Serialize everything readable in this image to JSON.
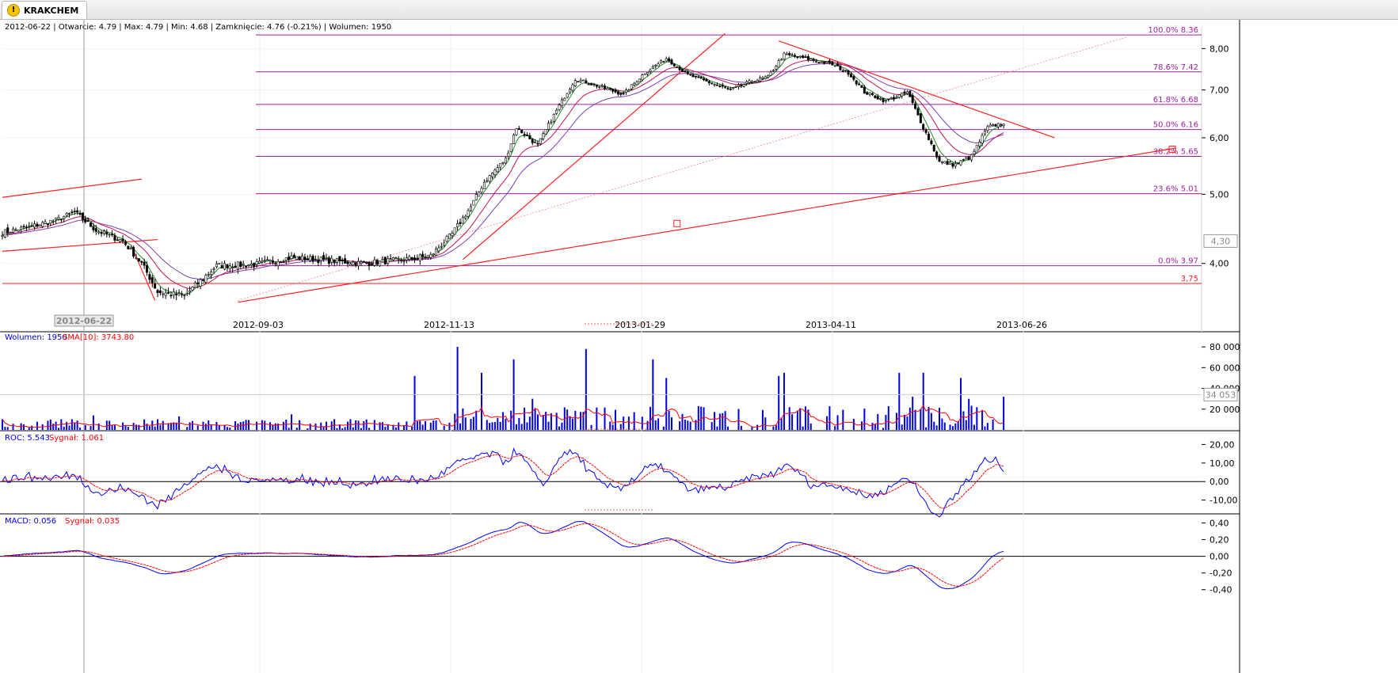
{
  "tab": {
    "title": "KRAKCHEM",
    "icon": "warning-icon"
  },
  "header": {
    "info": "2012-06-22 | Otwarcie: 4.79 | Max: 4.79 | Min: 4.68 | Zamknięcie: 4.76 (-0.21%)  | Wolumen: 1950",
    "cursor_date": "2012-06-22",
    "price_marker": "4,30",
    "volume_marker": "34 053"
  },
  "colors": {
    "candle": "#000000",
    "ema_fast": "#1f8a1f",
    "ema_mid": "#c0145a",
    "ema_slow": "#7b3fb5",
    "trend": "#ff2020",
    "fib": "#a020a0",
    "volume": "#0000dd",
    "signal": "#ff0000",
    "indicator": "#0000ff"
  },
  "chart_data": [
    {
      "type": "candlestick",
      "title": "",
      "x_ticks": [
        "2012-09-03",
        "2012-11-13",
        "2013-01-29",
        "2013-04-11",
        "2013-06-26"
      ],
      "y_ticks": [
        "8,00",
        "7,00",
        "6,00",
        "5,00",
        "4,00"
      ],
      "y_scale": "log",
      "ylim": [
        3.5,
        8.6
      ],
      "fibonacci": [
        {
          "label": "100.0% 8.36",
          "value": 8.36
        },
        {
          "label": "78.6% 7.42",
          "value": 7.42
        },
        {
          "label": "61.8% 6.68",
          "value": 6.68
        },
        {
          "label": "50.0% 6.16",
          "value": 6.16
        },
        {
          "label": "38.2% 5.65",
          "value": 5.65
        },
        {
          "label": "23.6% 5.01",
          "value": 5.01
        },
        {
          "label": "0.0% 3.97",
          "value": 3.97
        }
      ],
      "support_label": "3,75",
      "support_value": 3.75,
      "close_anchors": [
        [
          0,
          4.42
        ],
        [
          10,
          4.5
        ],
        [
          20,
          4.6
        ],
        [
          27,
          4.72
        ],
        [
          35,
          4.45
        ],
        [
          45,
          4.3
        ],
        [
          52,
          4.0
        ],
        [
          58,
          3.65
        ],
        [
          68,
          3.6
        ],
        [
          74,
          3.78
        ],
        [
          80,
          3.97
        ],
        [
          95,
          3.99
        ],
        [
          108,
          4.08
        ],
        [
          118,
          4.05
        ],
        [
          135,
          4.0
        ],
        [
          150,
          4.05
        ],
        [
          160,
          4.1
        ],
        [
          168,
          4.4
        ],
        [
          175,
          4.8
        ],
        [
          180,
          5.2
        ],
        [
          188,
          5.6
        ],
        [
          192,
          6.2
        ],
        [
          200,
          5.85
        ],
        [
          207,
          6.55
        ],
        [
          214,
          7.25
        ],
        [
          222,
          7.1
        ],
        [
          232,
          6.9
        ],
        [
          240,
          7.4
        ],
        [
          248,
          7.75
        ],
        [
          256,
          7.35
        ],
        [
          265,
          7.15
        ],
        [
          272,
          7.0
        ],
        [
          280,
          7.2
        ],
        [
          286,
          7.3
        ],
        [
          292,
          7.85
        ],
        [
          300,
          7.75
        ],
        [
          310,
          7.6
        ],
        [
          316,
          7.4
        ],
        [
          322,
          6.95
        ],
        [
          330,
          6.75
        ],
        [
          338,
          6.95
        ],
        [
          344,
          6.2
        ],
        [
          350,
          5.55
        ],
        [
          356,
          5.5
        ],
        [
          362,
          5.65
        ],
        [
          368,
          6.2
        ],
        [
          374,
          6.3
        ]
      ],
      "volume": {
        "label": "Wolumen: 1950",
        "sma_label": "SMA[10]: 3743.80",
        "y_ticks": [
          "80 000",
          "60 000",
          "40 000",
          "20 000"
        ],
        "ylim": [
          0,
          90000
        ],
        "spikes": [
          [
            18,
            10000
          ],
          [
            34,
            14000
          ],
          [
            66,
            13000
          ],
          [
            108,
            15000
          ],
          [
            154,
            52000
          ],
          [
            170,
            80000
          ],
          [
            179,
            55000
          ],
          [
            191,
            68000
          ],
          [
            198,
            30000
          ],
          [
            218,
            78000
          ],
          [
            243,
            68000
          ],
          [
            248,
            50000
          ],
          [
            290,
            52000
          ],
          [
            292,
            55000
          ],
          [
            335,
            55000
          ],
          [
            344,
            55000
          ],
          [
            358,
            50000
          ],
          [
            340,
            32000
          ],
          [
            361,
            30000
          ],
          [
            374,
            32000
          ]
        ]
      },
      "roc": {
        "label": "ROC: 5.543",
        "signal_label": "Sygnał: 1.061",
        "y_ticks": [
          "20,00",
          "10,00",
          "0,00",
          "-10,00"
        ],
        "ylim": [
          -17,
          27
        ]
      },
      "macd": {
        "label": "MACD: 0.056",
        "signal_label": "Sygnał: 0.035",
        "y_ticks": [
          "0,40",
          "0,20",
          "0,00",
          "-0,20",
          "-0,40"
        ],
        "ylim": [
          -0.45,
          0.5
        ]
      }
    }
  ]
}
